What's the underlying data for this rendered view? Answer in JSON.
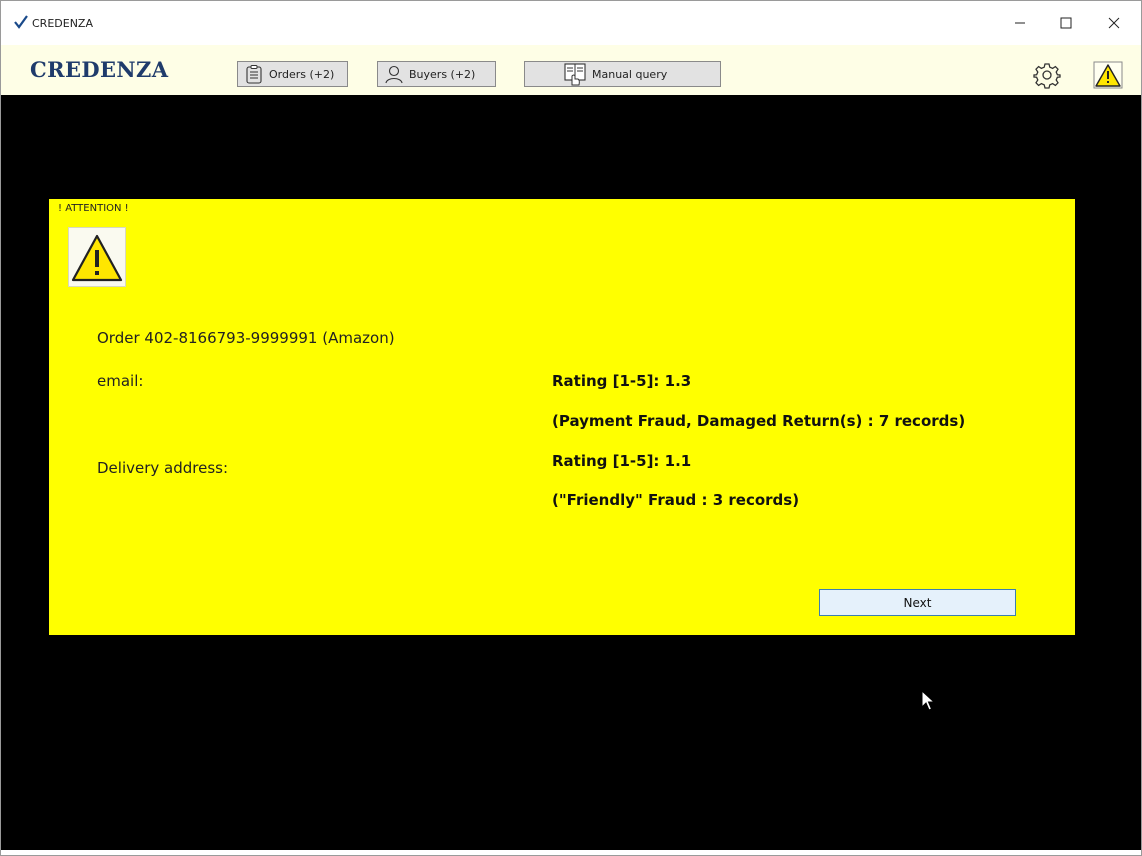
{
  "window": {
    "title": "CREDENZA",
    "controls": [
      "minimize",
      "maximize",
      "close"
    ]
  },
  "toolbar": {
    "brand": "CREDENZA",
    "orders_label": "Orders (+2)",
    "buyers_label": "Buyers (+2)",
    "manual_query_label": "Manual query",
    "icons": [
      "clipboard-icon",
      "user-icon",
      "manual-query-icon",
      "gear-icon",
      "warning-icon"
    ]
  },
  "alert": {
    "header": "! ATTENTION !",
    "order_line": "Order 402-8166793-9999991 (Amazon)",
    "email_label": "email:",
    "email_rating": "Rating [1-5]: 1.3",
    "email_detail": "(Payment Fraud, Damaged Return(s) : 7 records)",
    "address_label": "Delivery address:",
    "address_rating": "Rating [1-5]: 1.1",
    "address_detail": "(\"Friendly\" Fraud : 3 records)",
    "next_label": "Next"
  },
  "colors": {
    "panel": "#ffff00",
    "background": "#000000",
    "toolbar": "#fefee6",
    "brand": "#1f3b6b",
    "next_button": "#e5f1fb"
  }
}
